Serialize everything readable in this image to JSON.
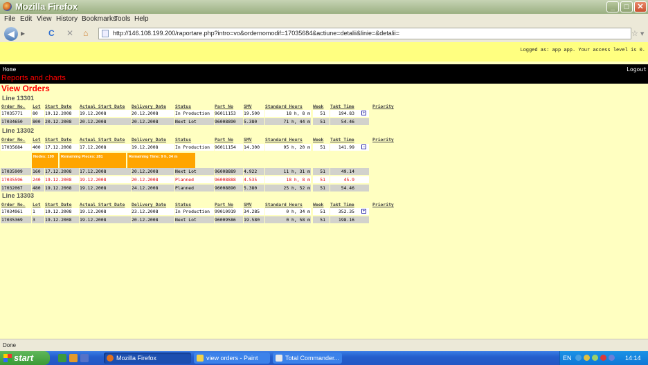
{
  "window": {
    "title": "Mozilla Firefox",
    "minimize": "_",
    "maximize": "□",
    "close": "✕"
  },
  "menu": [
    "File",
    "Edit",
    "View",
    "History",
    "Bookmarks",
    "Tools",
    "Help"
  ],
  "nav": {
    "url": "http://146.108.199.200/raportare.php?intro=vo&ordernomodif=17035684&actiune=detalii&linie=&detalii=",
    "back_icon": "◀",
    "forward_icon": "▸",
    "reload_icon": "C",
    "stop_icon": "✕",
    "home_icon": "⌂",
    "star_icon": "☆ ▾"
  },
  "page": {
    "login_text": "Logged as: app app. Your access level is 0.",
    "home_link": "Home",
    "logout_link": "Logout",
    "reports_title": "Reports and charts",
    "view_title": "View Orders",
    "headers": [
      "Order No.",
      "Lot",
      "Start Date",
      "Actual Start Date",
      "Delivery Date",
      "Status",
      "Part No",
      "SMV",
      "Standard Hours",
      "Week",
      "Takt Time",
      "Priority"
    ],
    "lines": [
      {
        "name": "Line 13301",
        "rows": [
          [
            "17035771",
            "80",
            "19.12.2008",
            "19.12.2008",
            "20.12.2008",
            "In Production",
            "96011153",
            "19.500",
            "18 h, 8 m",
            "51",
            "194.83"
          ],
          [
            "17034650",
            "800",
            "20.12.2008",
            "20.12.2008",
            "20.12.2008",
            "Next Lot",
            "96008890",
            "5.380",
            "71 h, 44 m",
            "51",
            "54.46"
          ]
        ]
      },
      {
        "name": "Line 13302",
        "rows": [
          [
            "17035684",
            "400",
            "17.12.2008",
            "17.12.2008",
            "19.12.2008",
            "In Production",
            "96011154",
            "14.300",
            "95 h, 20 m",
            "51",
            "141.99"
          ],
          [
            "17035909",
            "160",
            "17.12.2008",
            "17.12.2008",
            "20.12.2008",
            "Next Lot",
            "96008889",
            "4.922",
            "11 h, 31 m",
            "51",
            "49.14"
          ],
          [
            "17035596",
            "240",
            "19.12.2008",
            "19.12.2008",
            "20.12.2008",
            "Planned",
            "96008888",
            "4.535",
            "18 h, 8 m",
            "51",
            "45.9"
          ],
          [
            "17032067",
            "480",
            "19.12.2008",
            "19.12.2008",
            "24.12.2008",
            "Planned",
            "96008890",
            "5.380",
            "25 h, 52 m",
            "51",
            "54.46"
          ]
        ]
      },
      {
        "name": "Line 13303",
        "rows": [
          [
            "17034961",
            "1",
            "19.12.2008",
            "19.12.2008",
            "23.12.2008",
            "In Production",
            "99010919",
            "34.285",
            "0 h, 34 m",
            "51",
            "352.35"
          ],
          [
            "17035369",
            "3",
            "19.12.2008",
            "19.12.2008",
            "20.12.2008",
            "Next Lot",
            "96009586",
            "19.580",
            "0 h, 58 m",
            "51",
            "198.16"
          ]
        ]
      }
    ],
    "detail": {
      "nodes": "Nodes: 199",
      "remaining_pieces": "Remaining Pieces: 281",
      "remaining_time": "Remaining Time: 9 h, 34 m"
    },
    "expand_plus": "+",
    "expand_minus": "−"
  },
  "status": {
    "text": "Done"
  },
  "taskbar": {
    "start": "start",
    "tasks": [
      "Mozilla Firefox",
      "view orders - Paint",
      "Total Commander..."
    ],
    "lang": "EN",
    "clock": "14:14"
  }
}
